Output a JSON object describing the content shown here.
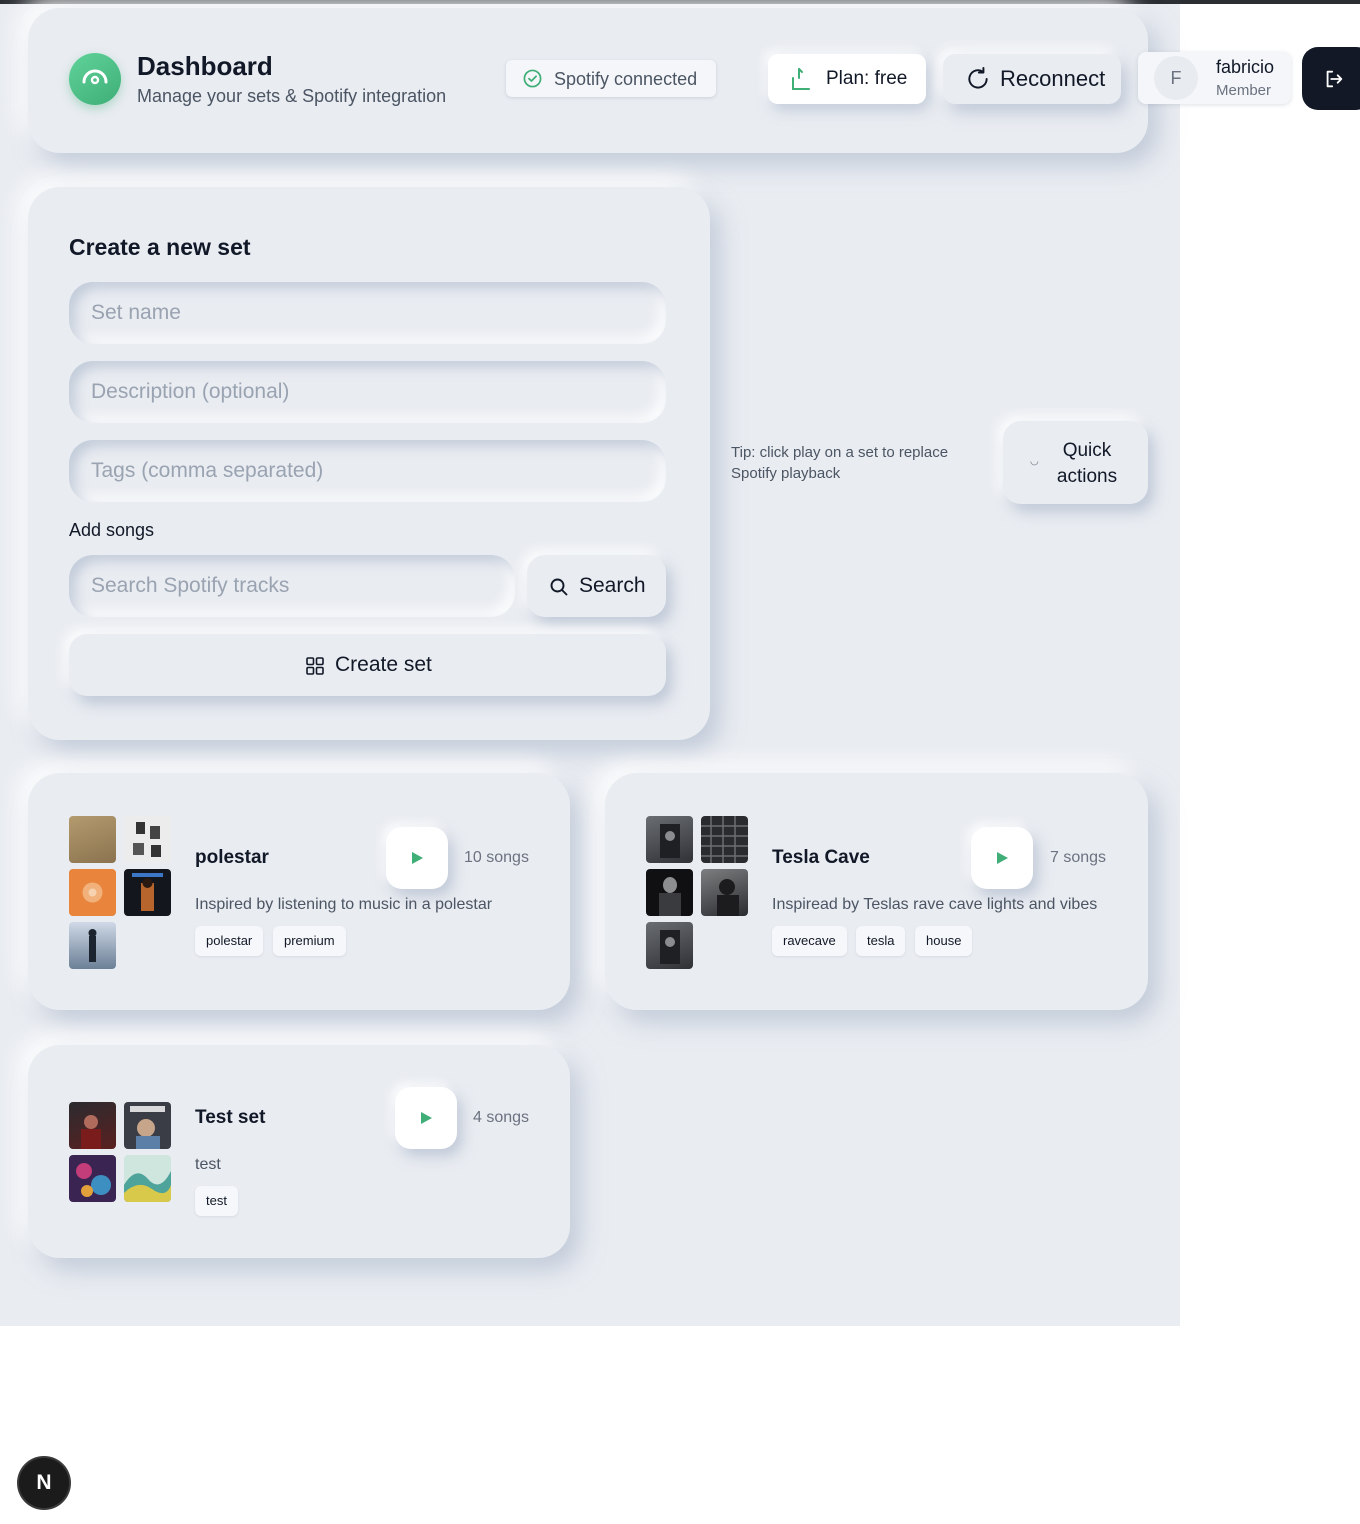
{
  "header": {
    "title": "Dashboard",
    "subtitle": "Manage your sets & Spotify integration",
    "spotify_status": "Spotify connected",
    "plan_label": "Plan: free",
    "reconnect_label": "Reconnect",
    "user": {
      "initial": "F",
      "name": "fabricio",
      "role": "Member"
    }
  },
  "create_set": {
    "title": "Create a new set",
    "name_placeholder": "Set name",
    "description_placeholder": "Description (optional)",
    "tags_placeholder": "Tags (comma separated)",
    "add_songs_label": "Add songs",
    "search_placeholder": "Search Spotify tracks",
    "search_button": "Search",
    "create_button": "Create set"
  },
  "tip": "Tip: click play on a set to replace Spotify playback",
  "quick_actions_label": "Quick actions",
  "sets": [
    {
      "name": "polestar",
      "song_count": "10 songs",
      "description": "Inspired by listening to music in a polestar",
      "tags": [
        "polestar",
        "premium"
      ],
      "thumb_colors": [
        "#a08a63",
        "#e9e9ea",
        "#e8843c",
        "#1a1b22",
        "#6e8da8"
      ]
    },
    {
      "name": "Tesla Cave",
      "song_count": "7 songs",
      "description": "Inspiread by Teslas rave cave lights and vibes",
      "tags": [
        "ravecave",
        "tesla",
        "house"
      ],
      "thumb_colors": [
        "#4a4d52",
        "#2c2d30",
        "#1c1c1e",
        "#5b5b5e",
        "#4a4d52"
      ]
    },
    {
      "name": "Test set",
      "song_count": "4 songs",
      "description": "test",
      "tags": [
        "test"
      ],
      "thumb_colors": [
        "#4a2a2a",
        "#3a3d45",
        "#5b3a7a",
        "#8fc7c0"
      ]
    }
  ],
  "dev_badge": "N",
  "colors": {
    "accent_green": "#3fae77",
    "background": "#e9ecf1",
    "dark_button": "#121826"
  }
}
